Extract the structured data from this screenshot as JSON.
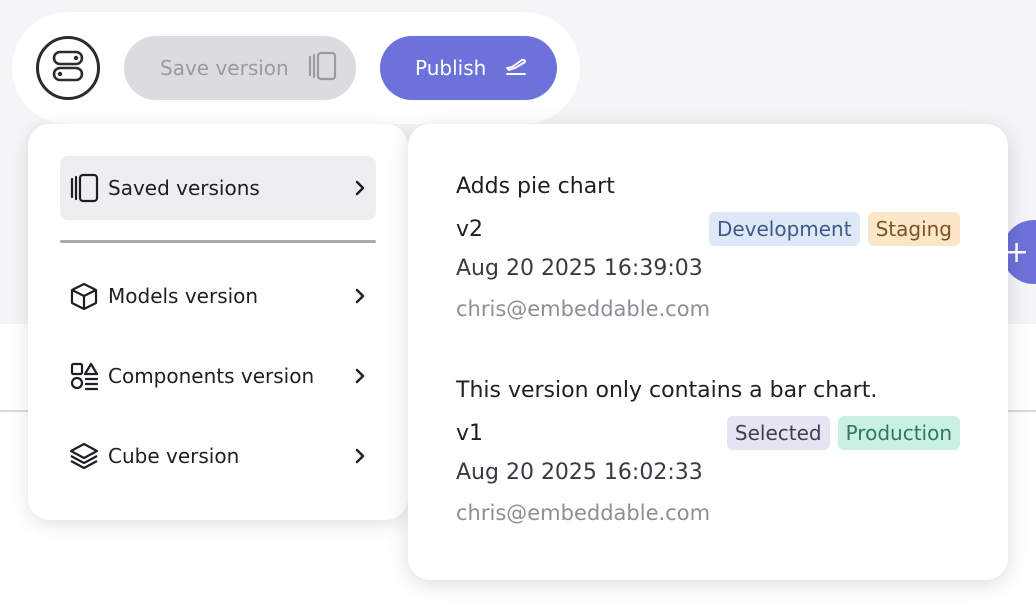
{
  "toolbar": {
    "menu_icon": "server-toggle-icon",
    "save_label": "Save version",
    "save_icon": "panels-icon",
    "publish_label": "Publish",
    "publish_icon": "plane-takeoff-icon"
  },
  "menu": {
    "items": [
      {
        "label": "Saved versions",
        "icon": "panels-icon",
        "active": true
      },
      {
        "label": "Models version",
        "icon": "cube-icon",
        "active": false
      },
      {
        "label": "Components version",
        "icon": "shapes-icon",
        "active": false
      },
      {
        "label": "Cube version",
        "icon": "layers-icon",
        "active": false
      }
    ]
  },
  "versions": [
    {
      "description": "Adds pie chart",
      "version": "v2",
      "badges": [
        {
          "label": "Development",
          "bg": "#dfe8f7",
          "fg": "#3c5a8c"
        },
        {
          "label": "Staging",
          "bg": "#fbe6c8",
          "fg": "#7a5525"
        }
      ],
      "date": "Aug 20 2025 16:39:03",
      "author": "chris@embeddable.com"
    },
    {
      "description": "This version only contains a bar chart.",
      "version": "v1",
      "badges": [
        {
          "label": "Selected",
          "bg": "#e4e4f2",
          "fg": "#40404a"
        },
        {
          "label": "Production",
          "bg": "#c9f0e0",
          "fg": "#2d7a5c"
        }
      ],
      "date": "Aug 20 2025 16:02:33",
      "author": "chris@embeddable.com"
    }
  ],
  "colors": {
    "accent": "#6c72d9",
    "disabled_bg": "#dcdce0",
    "active_item_bg": "#eeeef1"
  }
}
